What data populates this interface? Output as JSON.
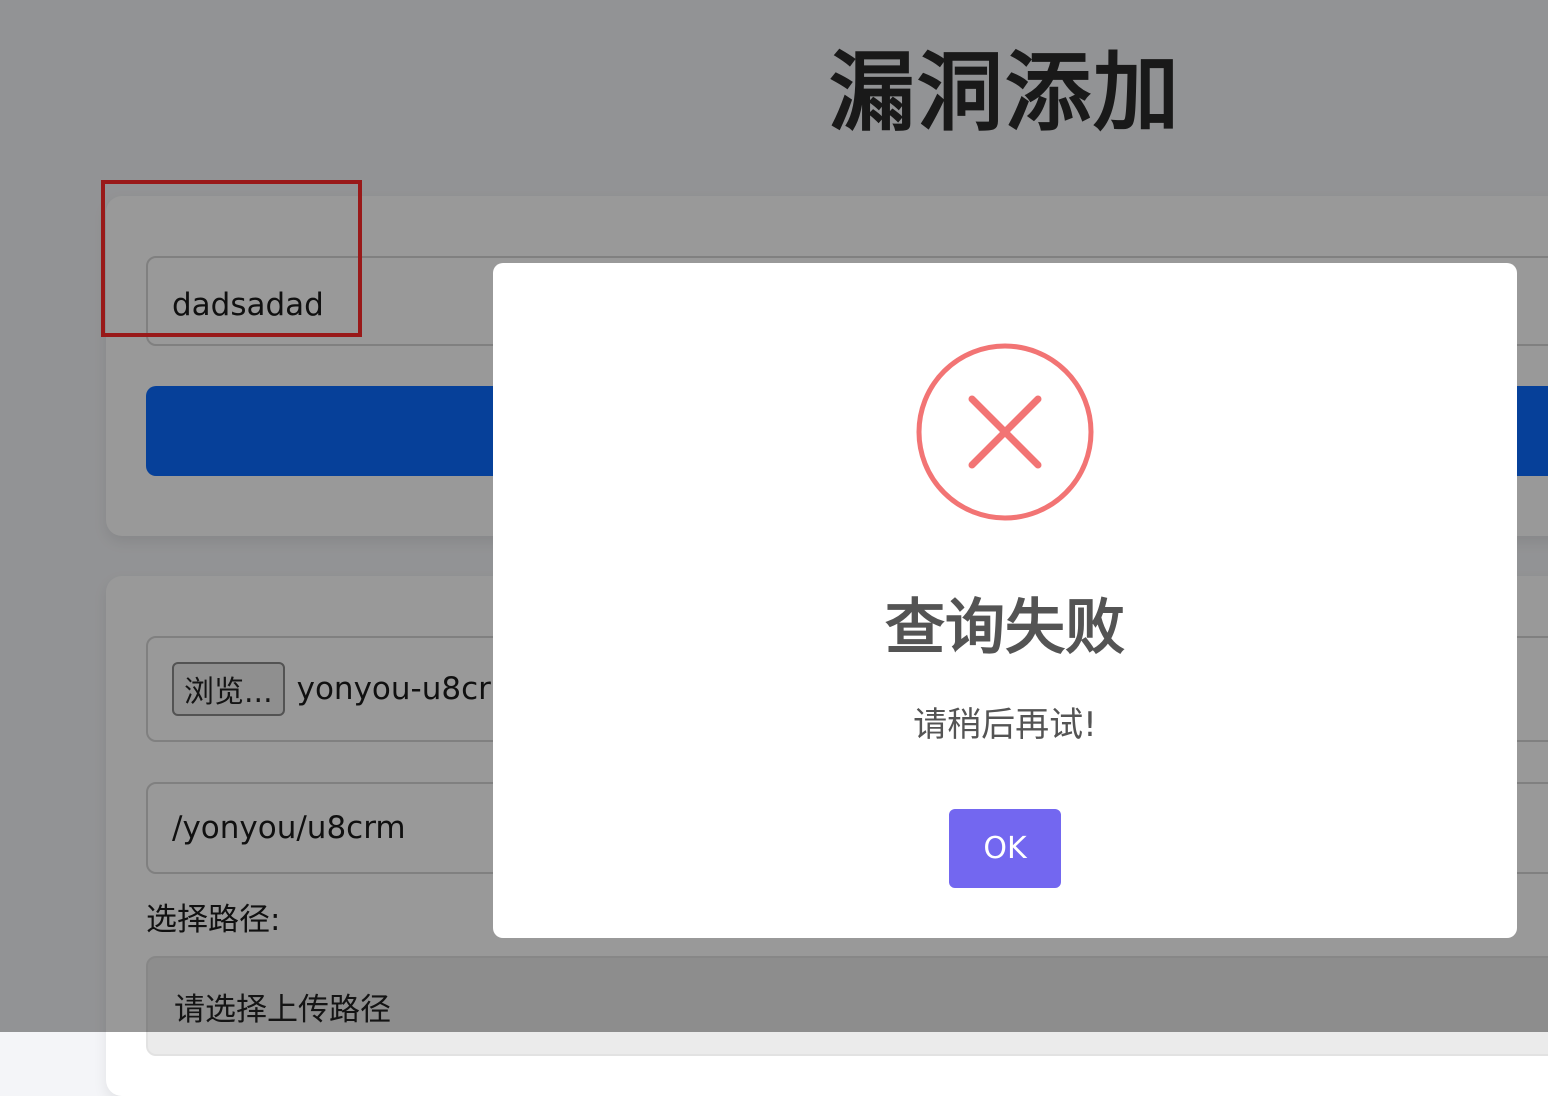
{
  "page": {
    "title": "漏洞添加"
  },
  "query": {
    "input_value": "dadsadad"
  },
  "upload": {
    "browse_label": "浏览...",
    "file_name": "yonyou-u8crm",
    "path_value": "/yonyou/u8crm",
    "path_label": "选择路径:",
    "select_placeholder": "请选择上传路径"
  },
  "dialog": {
    "icon": "error-x-icon",
    "icon_color": "#f27474",
    "title": "查询失败",
    "text": "请稍后再试!",
    "ok_label": "OK",
    "ok_color": "#7367f0"
  },
  "annotation": {
    "color": "#ff2a2a"
  }
}
